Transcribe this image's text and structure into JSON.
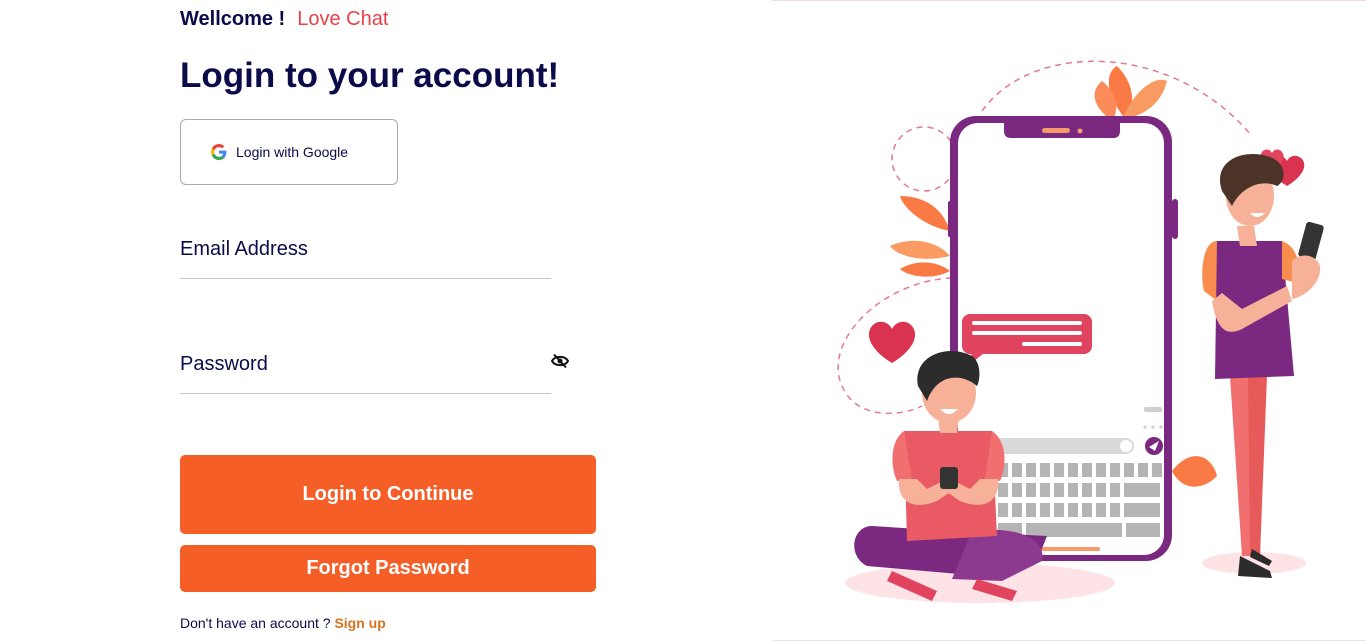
{
  "header": {
    "welcome_text": "Wellcome !",
    "brand_name": "Love Chat",
    "title": "Login to your account!"
  },
  "google_button": {
    "label": "Login with Google",
    "icon": "google-icon"
  },
  "form": {
    "email_label": "Email Address",
    "password_label": "Password",
    "password_toggle_icon": "eye-slash-icon"
  },
  "buttons": {
    "login_label": "Login to Continue",
    "forgot_label": "Forgot Password"
  },
  "signup": {
    "prompt": "Don't have an account ?",
    "link": "Sign up"
  },
  "colors": {
    "primary": "#f55e27",
    "heading": "#0b0b4a",
    "brand": "#ea4148",
    "link": "#d9731f"
  }
}
